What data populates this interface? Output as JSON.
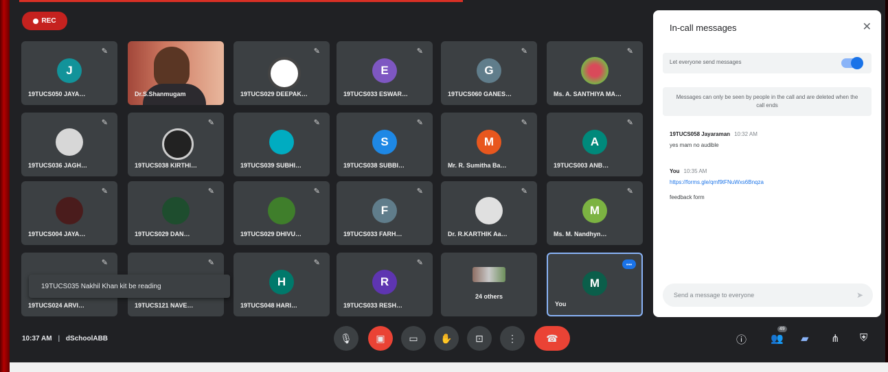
{
  "recording": {
    "label": "REC"
  },
  "tiles": [
    {
      "name": "19TUCS050 JAYA…",
      "initial": "J",
      "color": "#12939a"
    },
    {
      "name": "Dr.S.Shanmugam",
      "initial": "",
      "color": ""
    },
    {
      "name": "19TUCS029 DEEPAK…",
      "initial": "",
      "color": ""
    },
    {
      "name": "19TUCS033 ESWAR…",
      "initial": "E",
      "color": "#7e57c2"
    },
    {
      "name": "19TUCS060 GANES…",
      "initial": "G",
      "color": "#607d8b"
    },
    {
      "name": "Ms. A. SANTHIYA MA…",
      "initial": "",
      "color": ""
    },
    {
      "name": "19TUCS036 JAGH…",
      "initial": "",
      "color": ""
    },
    {
      "name": "19TUCS038 KIRTHI…",
      "initial": "",
      "color": ""
    },
    {
      "name": "19TUCS039 SUBHI…",
      "initial": "",
      "color": "#00acc1"
    },
    {
      "name": "19TUCS038 SUBBI…",
      "initial": "S",
      "color": "#1e88e5"
    },
    {
      "name": "Mr. R. Sumitha Ba…",
      "initial": "M",
      "color": "#e8571e"
    },
    {
      "name": "19TUCS003 ANB…",
      "initial": "A",
      "color": "#00897b"
    },
    {
      "name": "19TUCS004 JAYA…",
      "initial": "",
      "color": ""
    },
    {
      "name": "19TUCS029 DAN…",
      "initial": "",
      "color": ""
    },
    {
      "name": "19TUCS029 DHIVU…",
      "initial": "",
      "color": ""
    },
    {
      "name": "19TUCS033 FARH…",
      "initial": "F",
      "color": "#607d8b"
    },
    {
      "name": "Dr. R.KARTHIK Aa…",
      "initial": "",
      "color": ""
    },
    {
      "name": "Ms. M. Nandhyn…",
      "initial": "M",
      "color": "#7cb342"
    },
    {
      "name": "19TUCS024 ARVI…",
      "initial": "",
      "color": ""
    },
    {
      "name": "19TUCS121 NAVE…",
      "initial": "",
      "color": ""
    },
    {
      "name": "19TUCS048 HARI…",
      "initial": "H",
      "color": "#00796b"
    },
    {
      "name": "19TUCS033 RESH…",
      "initial": "R",
      "color": "#5e35b1"
    },
    {
      "name": "24 others",
      "initial": "",
      "color": ""
    },
    {
      "name": "You",
      "initial": "M",
      "color": "#0b5e4a"
    }
  ],
  "toast": {
    "text": "19TUCS035 Nakhil Khan kit be reading"
  },
  "chat": {
    "title": "In-call messages",
    "close": "✕",
    "toggle_label": "Let everyone send messages",
    "notice": "Messages can only be seen by people in the call and are deleted when the call ends",
    "messages": [
      {
        "author": "19TUCS058 Jayaraman",
        "time": "10:32 AM",
        "text": "yes mam no audible",
        "link": ""
      },
      {
        "author": "You",
        "time": "10:35 AM",
        "text": "",
        "link": "https://forms.gle/qmf9tFNuWxs6Bnqza"
      },
      {
        "author": "",
        "time": "",
        "text": "feedback form",
        "link": ""
      }
    ],
    "composer_placeholder": "Send a message to everyone"
  },
  "bottom_bar": {
    "time": "10:37 AM",
    "meeting": "dSchoolABB"
  },
  "colors": {
    "accent": "#1a73e8",
    "danger": "#ea4335",
    "bg": "#202124",
    "tile": "#3c4043"
  }
}
